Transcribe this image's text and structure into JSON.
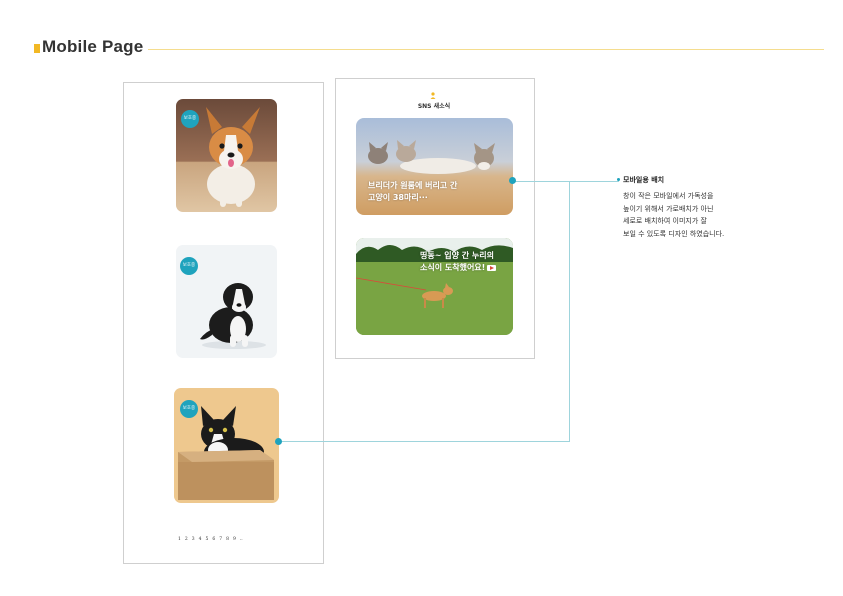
{
  "page": {
    "title": "Mobile Page"
  },
  "mobile_list": {
    "cards": [
      {
        "badge": "보호중",
        "animal": "corgi puppy"
      },
      {
        "badge": "보호중",
        "animal": "black and white puppy"
      },
      {
        "badge": "보호중",
        "animal": "tuxedo cat in box"
      }
    ],
    "pagination": [
      "1",
      "2",
      "3",
      "4",
      "5",
      "6",
      "7",
      "8",
      "9",
      ".."
    ]
  },
  "sns": {
    "title": "SNS 새소식",
    "posts": [
      {
        "text_line1": "브리더가 원룸에 버리고 간",
        "text_line2": "고양이 38마리···"
      },
      {
        "text_line1": "띵동~ 입양 간 누리의",
        "text_line2": "소식이 도착했어요!"
      }
    ]
  },
  "annotation": {
    "title": "모바일용 배치",
    "lines": [
      "창이 작은 모바일에서 가독성을",
      "높이기 위해서 가로배치가 아닌",
      "세로로 배치하여 이미지가 잘",
      "보일 수 있도록 디자인 하였습니다."
    ]
  },
  "colors": {
    "accent": "#1fa3bd",
    "title_bar": "#f2b824",
    "rule": "#f5dd8e",
    "connector": "#9ed4dc"
  }
}
